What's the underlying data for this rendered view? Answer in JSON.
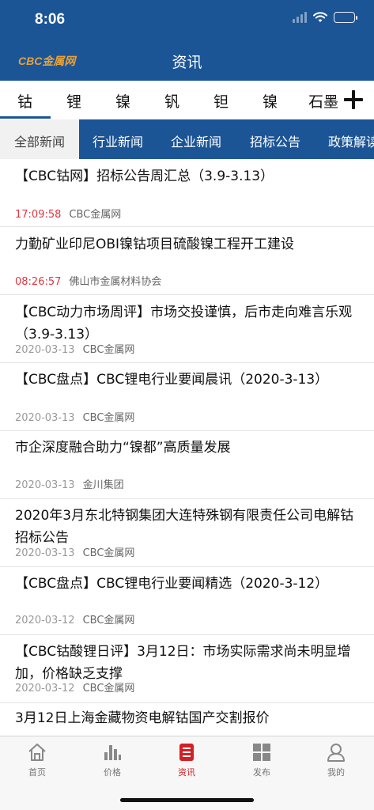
{
  "status_bar": {
    "time": "8:06",
    "battery_level": 0.25
  },
  "header": {
    "brand": "CBC金属网",
    "title": "资讯"
  },
  "metal_tabs": [
    "钴",
    "锂",
    "镍",
    "钒",
    "钽",
    "镍",
    "石墨"
  ],
  "category_tabs": [
    "全部新闻",
    "行业新闻",
    "企业新闻",
    "招标公告",
    "政策解读"
  ],
  "news": [
    {
      "title": "【CBC钴网】招标公告周汇总（3.9-3.13）",
      "time": "17:09:58",
      "source": "CBC金属网"
    },
    {
      "title": "力勤矿业印尼OBI镍钴项目硫酸镍工程开工建设",
      "time": "08:26:57",
      "source": "佛山市金属材料协会"
    },
    {
      "title": "【CBC动力市场周评】市场交投谨慎，后市走向难言乐观（3.9-3.13）",
      "time": "2020-03-13",
      "source": "CBC金属网"
    },
    {
      "title": "【CBC盘点】CBC锂电行业要闻晨讯（2020-3-13）",
      "time": "2020-03-13",
      "source": "CBC金属网"
    },
    {
      "title": "市企深度融合助力“镍都”高质量发展",
      "time": "2020-03-13",
      "source": "金川集团"
    },
    {
      "title": "2020年3月东北特钢集团大连特殊钢有限责任公司电解钴招标公告",
      "time": "2020-03-13",
      "source": "CBC金属网"
    },
    {
      "title": "【CBC盘点】CBC锂电行业要闻精选（2020-3-12）",
      "time": "2020-03-12",
      "source": "CBC金属网"
    },
    {
      "title": "【CBC钴酸锂日评】3月12日：市场实际需求尚未明显增加，价格缺乏支撑",
      "time": "2020-03-12",
      "source": "CBC金属网"
    },
    {
      "title": "3月12日上海金藏物资电解钴国产交割报价",
      "time": "",
      "source": ""
    }
  ],
  "tab_bar": [
    {
      "label": "首页",
      "icon": "home-icon"
    },
    {
      "label": "价格",
      "icon": "bar-chart-icon"
    },
    {
      "label": "资讯",
      "icon": "news-icon"
    },
    {
      "label": "发布",
      "icon": "grid-icon"
    },
    {
      "label": "我的",
      "icon": "user-icon"
    }
  ]
}
